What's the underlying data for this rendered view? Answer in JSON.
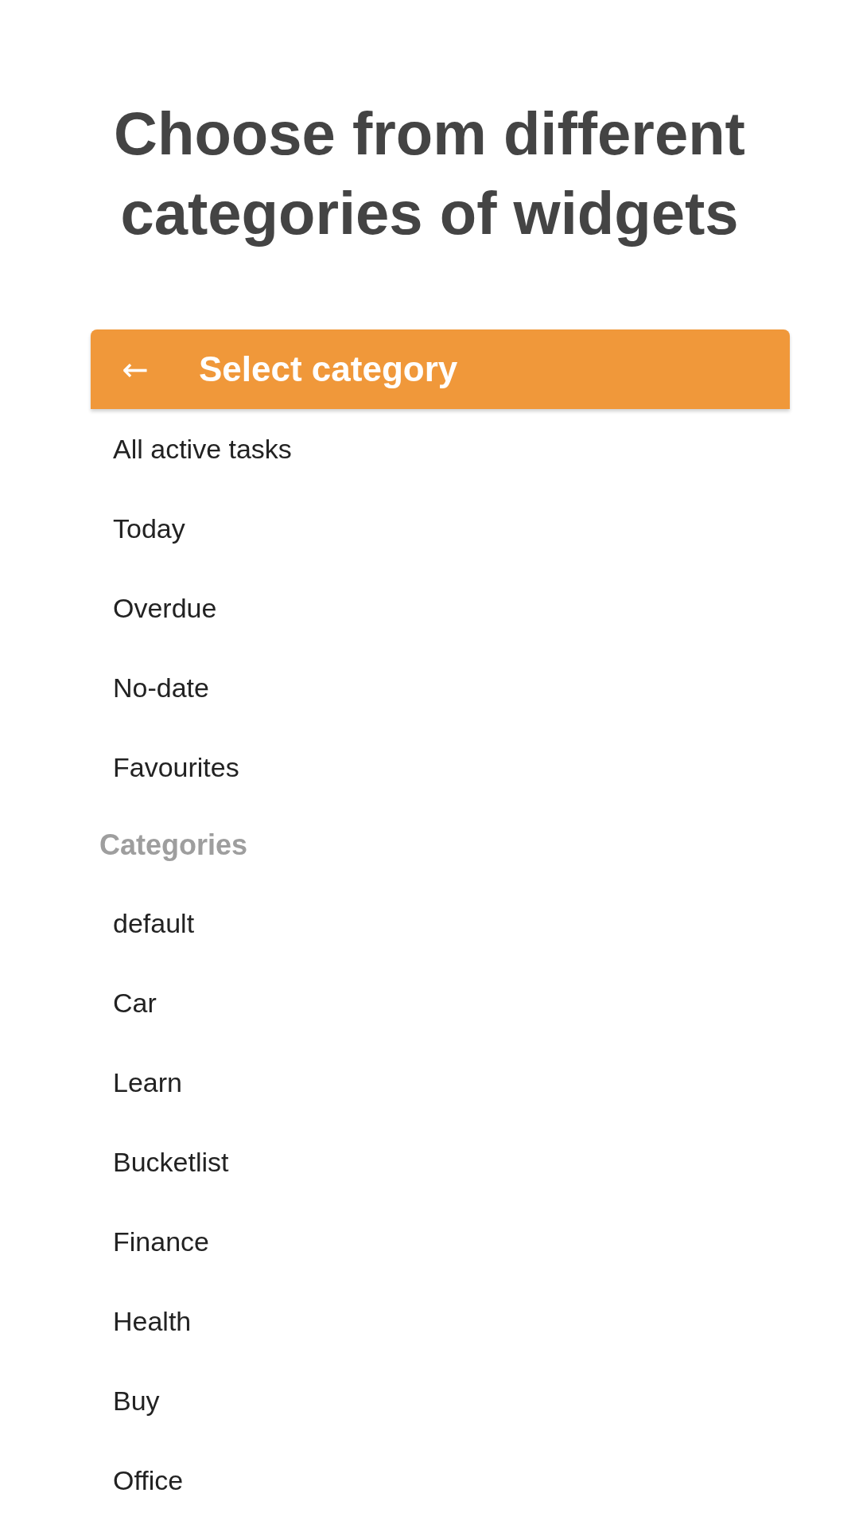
{
  "headline": "Choose from different categories of widgets",
  "app_bar": {
    "back_icon": "←",
    "title": "Select category"
  },
  "list": [
    {
      "kind": "item",
      "label": "All active tasks"
    },
    {
      "kind": "item",
      "label": "Today"
    },
    {
      "kind": "item",
      "label": "Overdue"
    },
    {
      "kind": "item",
      "label": "No-date"
    },
    {
      "kind": "item",
      "label": "Favourites"
    },
    {
      "kind": "header",
      "label": "Categories"
    },
    {
      "kind": "item",
      "label": "default"
    },
    {
      "kind": "item",
      "label": "Car"
    },
    {
      "kind": "item",
      "label": "Learn"
    },
    {
      "kind": "item",
      "label": "Bucketlist"
    },
    {
      "kind": "item",
      "label": "Finance"
    },
    {
      "kind": "item",
      "label": "Health"
    },
    {
      "kind": "item",
      "label": "Buy"
    },
    {
      "kind": "item",
      "label": "Office"
    }
  ]
}
